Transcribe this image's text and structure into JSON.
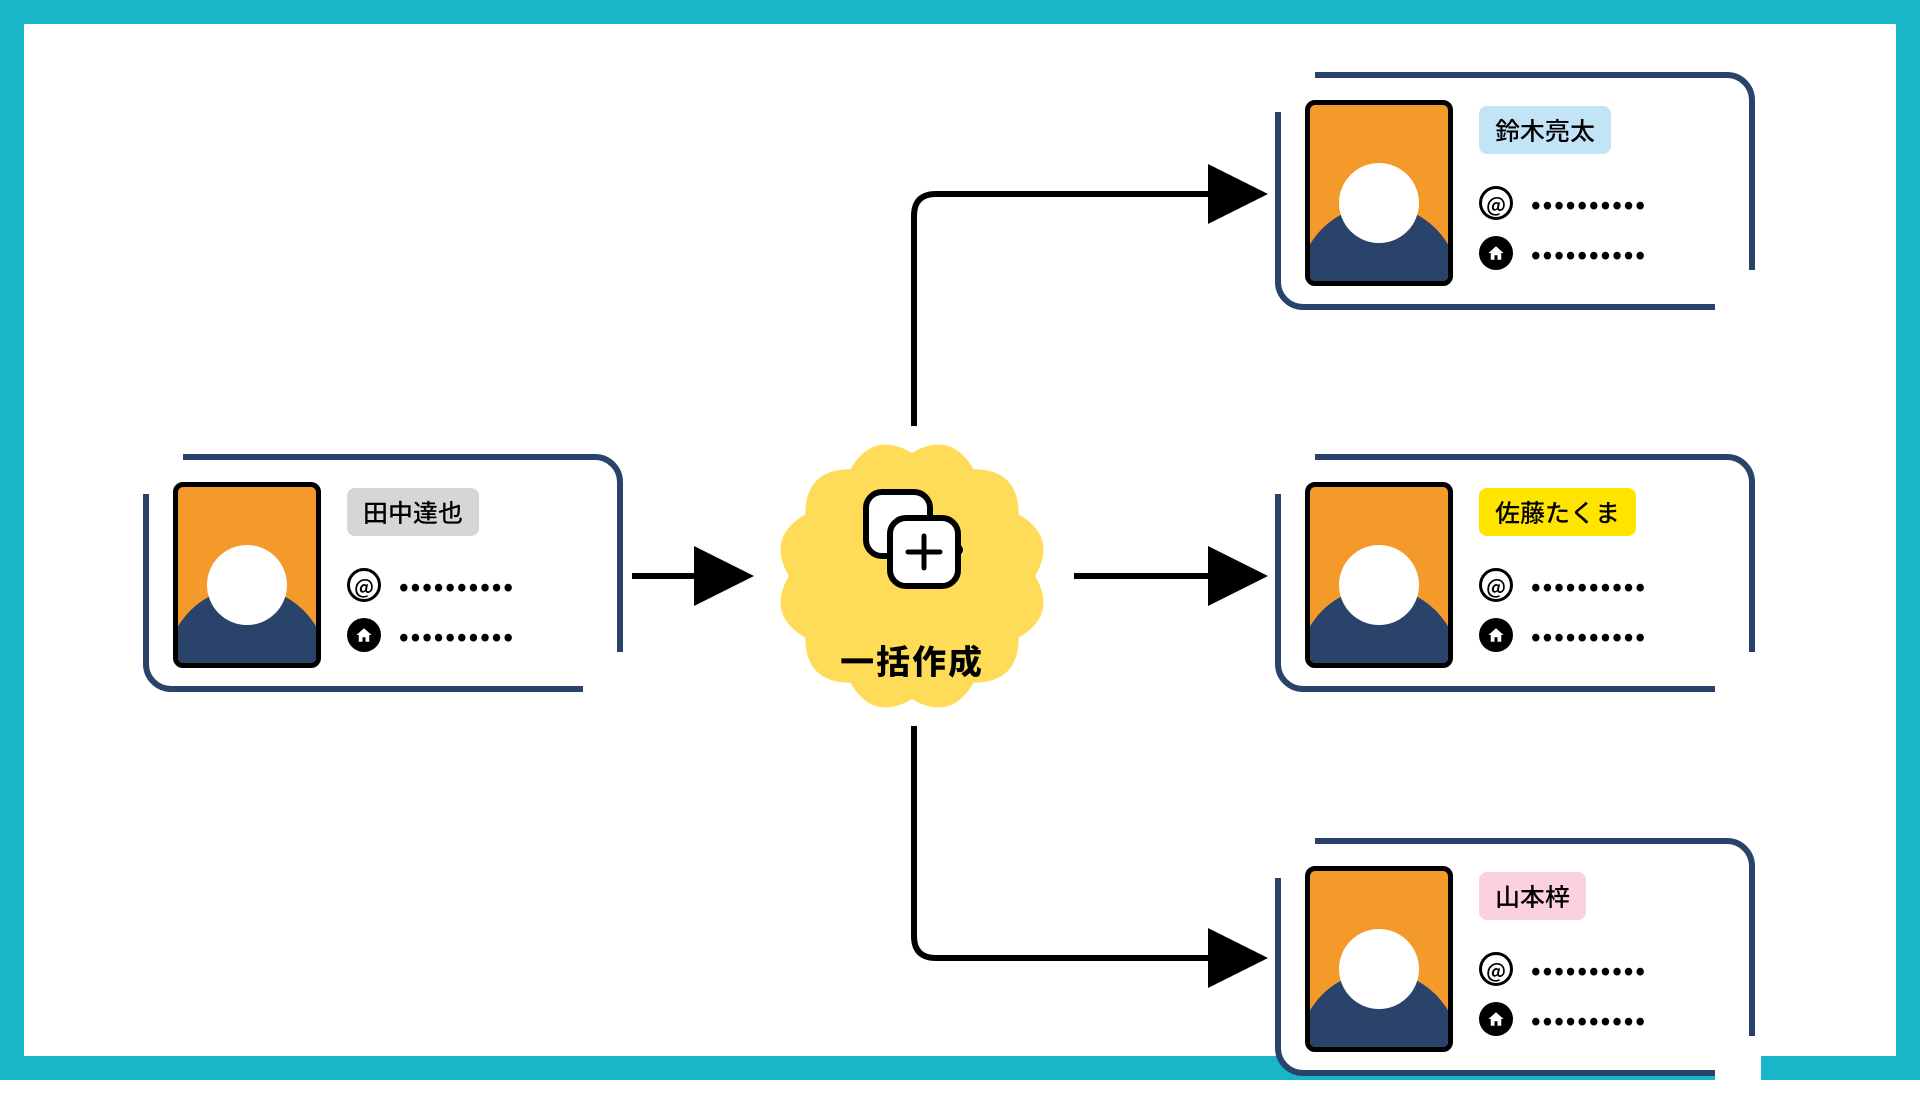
{
  "badge_label": "一括作成",
  "source_card": {
    "name": "田中達也",
    "name_bg": "#d6d6d6",
    "email_placeholder": "••••••••••",
    "home_placeholder": "••••••••••"
  },
  "output_cards": [
    {
      "name": "鈴木亮太",
      "name_bg": "#c2e4f6",
      "email_placeholder": "••••••••••",
      "home_placeholder": "••••••••••"
    },
    {
      "name": "佐藤たくま",
      "name_bg": "#ffe400",
      "email_placeholder": "••••••••••",
      "home_placeholder": "••••••••••"
    },
    {
      "name": "山本梓",
      "name_bg": "#fcd1df",
      "email_placeholder": "••••••••••",
      "home_placeholder": "••••••••••"
    }
  ],
  "colors": {
    "frame": "#19b6c9",
    "card_border": "#29436a",
    "portrait_bg": "#f39a2b",
    "portrait_body": "#29436a",
    "badge_fill": "#ffdc58"
  }
}
